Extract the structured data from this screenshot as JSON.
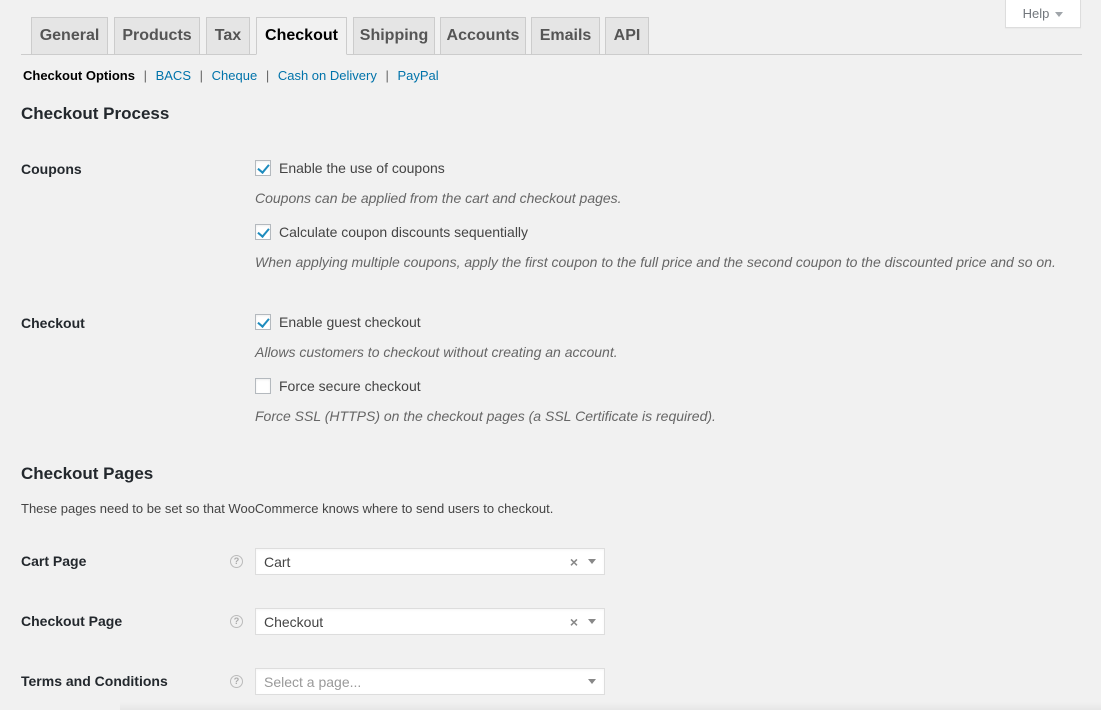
{
  "help": {
    "label": "Help"
  },
  "tabs": [
    {
      "label": "General"
    },
    {
      "label": "Products"
    },
    {
      "label": "Tax"
    },
    {
      "label": "Checkout"
    },
    {
      "label": "Shipping"
    },
    {
      "label": "Accounts"
    },
    {
      "label": "Emails"
    },
    {
      "label": "API"
    }
  ],
  "active_tab": "Checkout",
  "subnav": {
    "current": "Checkout Options",
    "links": [
      "BACS",
      "Cheque",
      "Cash on Delivery",
      "PayPal"
    ],
    "separator": "|"
  },
  "checkout_process": {
    "title": "Checkout Process",
    "coupons": {
      "label": "Coupons",
      "enable": {
        "label": "Enable the use of coupons",
        "checked": true
      },
      "enable_desc": "Coupons can be applied from the cart and checkout pages.",
      "sequential": {
        "label": "Calculate coupon discounts sequentially",
        "checked": true
      },
      "sequential_desc": "When applying multiple coupons, apply the first coupon to the full price and the second coupon to the discounted price and so on."
    },
    "checkout": {
      "label": "Checkout",
      "guest": {
        "label": "Enable guest checkout",
        "checked": true
      },
      "guest_desc": "Allows customers to checkout without creating an account.",
      "secure": {
        "label": "Force secure checkout",
        "checked": false
      },
      "secure_desc": "Force SSL (HTTPS) on the checkout pages (a SSL Certificate is required)."
    }
  },
  "checkout_pages": {
    "title": "Checkout Pages",
    "intro": "These pages need to be set so that WooCommerce knows where to send users to checkout.",
    "cart_page": {
      "label": "Cart Page",
      "value": "Cart",
      "clear": "×"
    },
    "checkout_page": {
      "label": "Checkout Page",
      "value": "Checkout",
      "clear": "×"
    },
    "terms_page": {
      "label": "Terms and Conditions",
      "placeholder": "Select a page..."
    }
  },
  "help_tip_glyph": "?",
  "colors": {
    "link": "#0073aa",
    "checkmark": "#1e8cbe",
    "background": "#f1f1f1"
  }
}
